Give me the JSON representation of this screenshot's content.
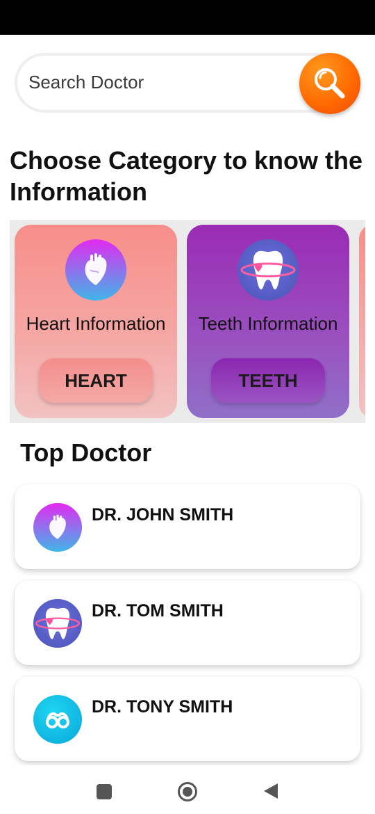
{
  "search": {
    "placeholder": "Search Doctor",
    "button_icon": "search-icon"
  },
  "category_section": {
    "title": "Choose Category to know the Information",
    "cards": [
      {
        "label": "Heart Information",
        "button": "HEART",
        "icon": "heart-icon",
        "color": "#f78e8a"
      },
      {
        "label": "Teeth Information",
        "button": "TEETH",
        "icon": "tooth-icon",
        "color": "#9a2bb4"
      }
    ]
  },
  "top_doctor": {
    "title": "Top Doctor",
    "doctors": [
      {
        "name": "DR. JOHN SMITH",
        "icon": "heart-icon"
      },
      {
        "name": "DR. TOM SMITH",
        "icon": "tooth-icon"
      },
      {
        "name": "DR. TONY SMITH",
        "icon": "eye-icon"
      }
    ]
  },
  "colors": {
    "accent": "#ff6b00"
  },
  "nav": {
    "recents_icon": "recents-icon",
    "home_icon": "home-icon",
    "back_icon": "back-icon"
  }
}
